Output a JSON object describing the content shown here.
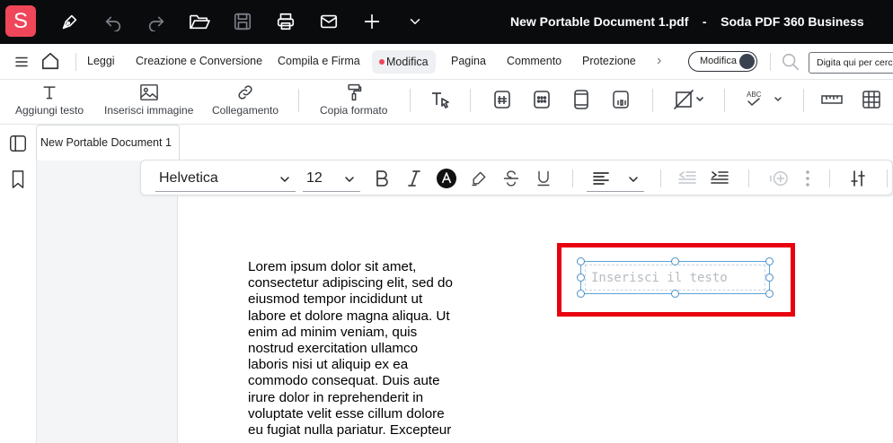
{
  "app": {
    "logo_letter": "S",
    "document_title": "New Portable Document 1.pdf",
    "title_separator": "-",
    "product_name": "Soda PDF 360 Business"
  },
  "titlebar_icons": [
    "pen-icon",
    "undo-icon",
    "redo-icon",
    "folder-open-icon",
    "save-icon",
    "print-icon",
    "mail-icon",
    "plus-icon",
    "chevron-down-icon"
  ],
  "menu": {
    "items": [
      "Leggi",
      "Creazione e Conversione",
      "Compila e Firma",
      "Modifica",
      "Pagina",
      "Commento",
      "Protezione"
    ],
    "active": "Modifica",
    "more": "›",
    "mode_toggle_label": "Modifica",
    "search_placeholder": "Digita qui per cercare"
  },
  "tools": {
    "add_text": "Aggiungi testo",
    "insert_image": "Inserisci immagine",
    "link": "Collegamento",
    "copy_format": "Copia formato"
  },
  "tab": {
    "label": "New Portable Document 1"
  },
  "format": {
    "font": "Helvetica",
    "size": "12"
  },
  "body_lines": [
    "Lorem ipsum dolor sit amet,",
    "consectetur adipiscing elit, sed do",
    "eiusmod tempor incididunt ut",
    "labore et dolore magna aliqua. Ut",
    "enim ad minim veniam, quis",
    "nostrud exercitation ullamco",
    "laboris nisi ut aliquip ex ea",
    "commodo consequat. Duis aute",
    "irure dolor in reprehenderit in",
    "voluptate velit esse cillum dolore",
    "eu fugiat nulla pariatur. Excepteur"
  ],
  "textbox": {
    "placeholder": "Inserisci il testo"
  },
  "colors": {
    "brand": "#f0465a",
    "titlebar": "#0a0b0d",
    "highlight": "#e8000f",
    "selection": "#4a90c8"
  }
}
